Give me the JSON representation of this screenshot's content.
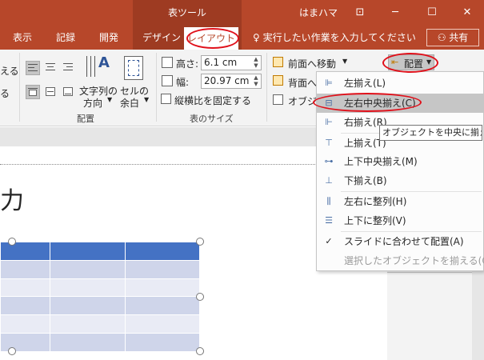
{
  "titlebar": {
    "context_tab": "表ツール",
    "user": "はまハマ",
    "ribbon_display_glyph": "⊡",
    "minimize_glyph": "─",
    "maximize_glyph": "☐",
    "close_glyph": "✕"
  },
  "tabs": [
    {
      "label": "表示"
    },
    {
      "label": "記録"
    },
    {
      "label": "開発"
    },
    {
      "label": "デザイン"
    },
    {
      "label": "レイアウト"
    }
  ],
  "tell_me": "実行したい作業を入力してください",
  "share": "共有",
  "ribbon": {
    "left_partial": [
      "える",
      "る"
    ],
    "align_group_label": "配置",
    "text_direction": [
      "文字列の",
      "方向"
    ],
    "cell_margin": [
      "セルの",
      "余白"
    ],
    "height_label": "高さ:",
    "height_value": "6.1 cm",
    "width_label": "幅:",
    "width_value": "20.97 cm",
    "lock_aspect": "縦横比を固定する",
    "size_group_label": "表のサイズ",
    "bring_forward": "前面へ移動",
    "send_backward": "背面へ",
    "selection_pane": "オブジ",
    "arrange": "配置"
  },
  "slide": {
    "title_fragment": "力"
  },
  "dropdown": {
    "items": [
      {
        "label": "左揃え(L)",
        "icon": "align-left-icon"
      },
      {
        "label": "左右中央揃え(C)",
        "icon": "align-center-icon"
      },
      {
        "label": "右揃え(R)",
        "icon": "align-right-icon"
      },
      {
        "label": "上揃え(T)",
        "icon": "align-top-icon"
      },
      {
        "label": "上下中央揃え(M)",
        "icon": "align-middle-icon"
      },
      {
        "label": "下揃え(B)",
        "icon": "align-bottom-icon"
      },
      {
        "label": "左右に整列(H)",
        "icon": "distribute-horizontal-icon"
      },
      {
        "label": "上下に整列(V)",
        "icon": "distribute-vertical-icon"
      },
      {
        "label": "スライドに合わせて配置(A)",
        "icon": "check-icon"
      },
      {
        "label": "選択したオブジェクトを揃える(O)",
        "icon": ""
      }
    ]
  },
  "tooltip": "オブジェクトを中央に揃える",
  "colors": {
    "titlebar": "#b7472a",
    "context_tab": "#9e3b22",
    "annotation": "#e0101a",
    "table_header": "#4472c4",
    "table_row_dark": "#cfd5ea",
    "table_row_light": "#e9ebf5"
  }
}
